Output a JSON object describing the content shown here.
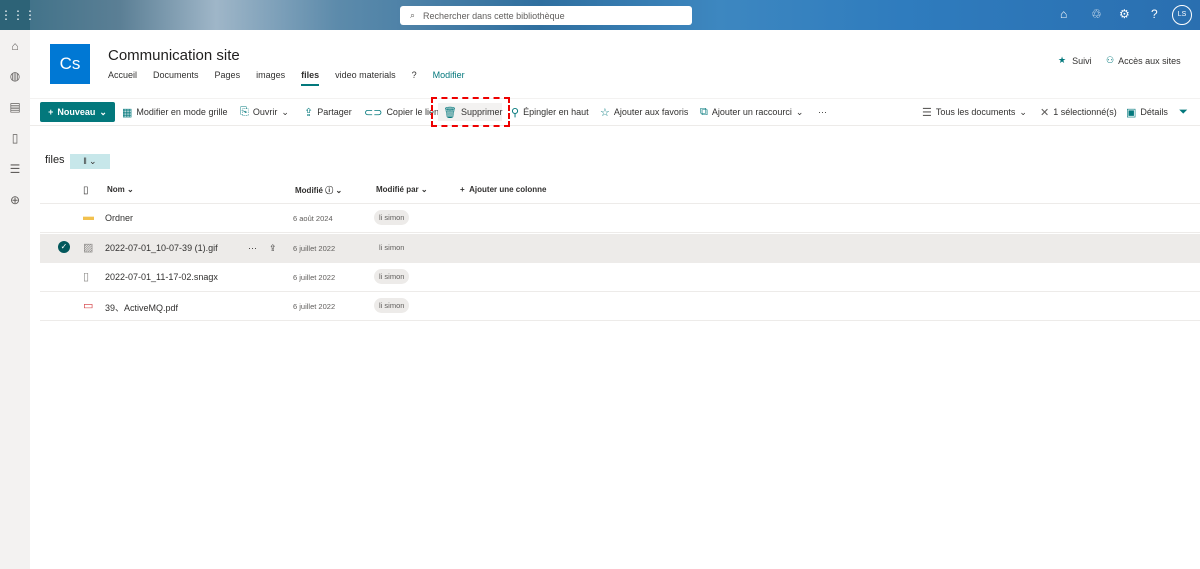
{
  "topbar": {
    "search_placeholder": "Rechercher dans cette bibliothèque",
    "avatar": "LS"
  },
  "site": {
    "logo": "Cs",
    "title": "Communication site",
    "nav": [
      "Accueil",
      "Documents",
      "Pages",
      "images",
      "files",
      "video materials",
      "?"
    ],
    "edit": "Modifier",
    "follow": "Suivi",
    "sites_access": "Accès aux sites"
  },
  "commands": {
    "new": "Nouveau",
    "grid": "Modifier en mode grille",
    "open": "Ouvrir",
    "share": "Partager",
    "copy_link": "Copier le lien",
    "delete": "Supprimer",
    "pin": "Épingler en haut",
    "favorites": "Ajouter aux favoris",
    "shortcut": "Ajouter un raccourci",
    "more": "···",
    "view": "Tous les documents",
    "selected": "1 sélectionné(s)",
    "details": "Détails"
  },
  "library": {
    "title": "files"
  },
  "columns": {
    "name": "Nom",
    "modified": "Modifié",
    "modified_by": "Modifié par",
    "add": "Ajouter une colonne"
  },
  "rows": [
    {
      "name": "Ordner",
      "date": "6 août 2024",
      "by": "li simon",
      "type": "folder"
    },
    {
      "name": "2022-07-01_10-07-39 (1).gif",
      "date": "6 juillet 2022",
      "by": "li simon",
      "type": "image",
      "selected": true
    },
    {
      "name": "2022-07-01_11-17-02.snagx",
      "date": "6 juillet 2022",
      "by": "li simon",
      "type": "file"
    },
    {
      "name": "39、ActiveMQ.pdf",
      "date": "6 juillet 2022",
      "by": "li simon",
      "type": "pdf"
    }
  ],
  "colors": {
    "accent": "#03787c",
    "logo": "#0078d4",
    "highlight": "#e00000"
  }
}
